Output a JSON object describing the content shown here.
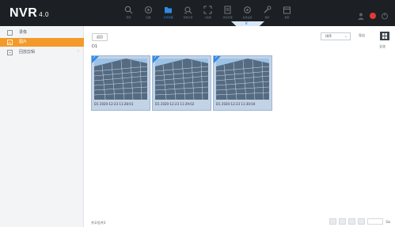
{
  "app": {
    "logo": "NVR",
    "version": "4.0"
  },
  "nav": [
    {
      "label": "预览",
      "icon": "search-icon"
    },
    {
      "label": "回放",
      "icon": "playback-icon"
    },
    {
      "label": "文件管理",
      "icon": "folder-icon",
      "active": true
    },
    {
      "label": "智能分析",
      "icon": "smart-search-icon"
    },
    {
      "label": "人脸库",
      "icon": "face-icon"
    },
    {
      "label": "通道管理",
      "icon": "list-icon"
    },
    {
      "label": "系统设置",
      "icon": "settings-icon"
    },
    {
      "label": "维护",
      "icon": "wrench-icon"
    },
    {
      "label": "报警",
      "icon": "calendar-icon"
    }
  ],
  "dropdown_tab": {
    "label": "∨"
  },
  "sidebar": {
    "items": [
      {
        "label": "录像",
        "icon": "video-icon"
      },
      {
        "label": "图片",
        "icon": "image-icon",
        "active": true
      },
      {
        "label": "回放剪辑",
        "icon": "clip-icon"
      }
    ]
  },
  "toolbar": {
    "back_label": "返回",
    "folder_path": "D1",
    "sort_label": "排序",
    "export_label": "导出",
    "select_all_label": "全选"
  },
  "thumbnails": [
    {
      "caption": "D1 2020-12-23 11:28:01"
    },
    {
      "caption": "D1 2020-12-23 11:29:02"
    },
    {
      "caption": "D1 2020-12-23 11:30:04"
    }
  ],
  "status": {
    "text": "共3/总共3"
  },
  "pager": {
    "go_label": "Go"
  },
  "colors": {
    "accent": "#2e8ae6",
    "active_side": "#f39a2a",
    "topbar": "#1c2024",
    "alarm": "#e53935"
  }
}
